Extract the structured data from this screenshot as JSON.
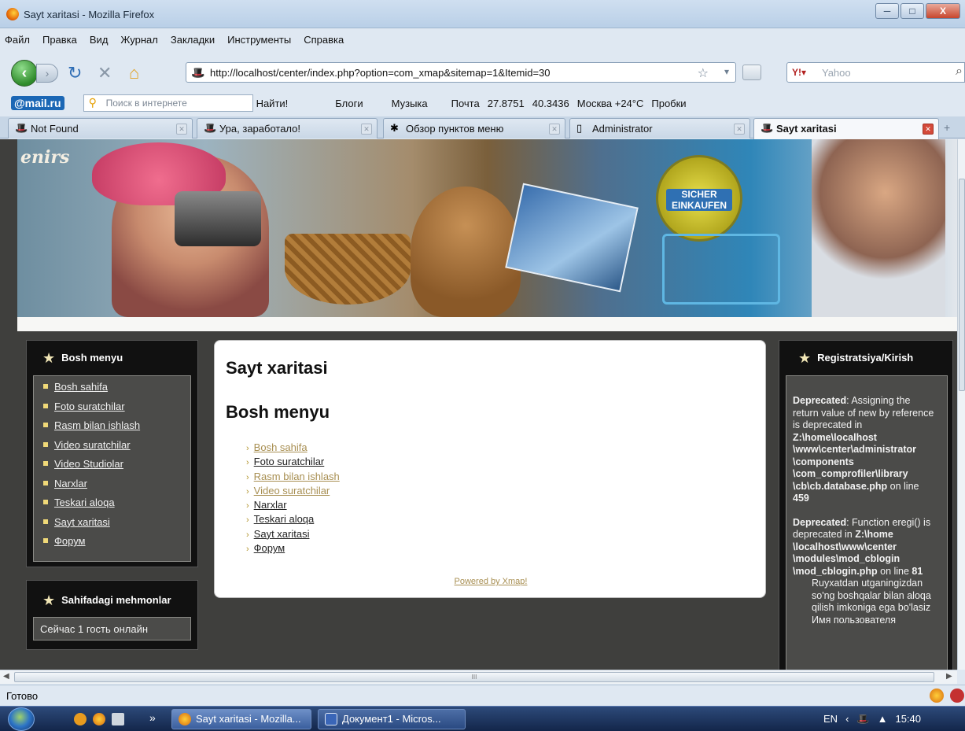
{
  "window": {
    "title": "Sayt xaritasi - Mozilla Firefox",
    "buttons": {
      "minimize": "─",
      "maximize": "□",
      "close": "X"
    }
  },
  "menubar": [
    "Файл",
    "Правка",
    "Вид",
    "Журнал",
    "Закладки",
    "Инструменты",
    "Справка"
  ],
  "navbar": {
    "url": "http://localhost/center/index.php?option=com_xmap&sitemap=1&Itemid=30",
    "search_placeholder": "Yahoo"
  },
  "mail_toolbar": {
    "logo": "@mail.ru",
    "search_placeholder": "Поиск в интернете",
    "find": "Найти!",
    "blogs": "Блоги",
    "music": "Музыка",
    "mail": "Почта",
    "usd": "27.8751",
    "eur": "40.3436",
    "weather": "Москва +24°C",
    "traffic": "Пробки"
  },
  "tabs": [
    {
      "label": "Not Found",
      "active": false
    },
    {
      "label": "Ура, заработало!",
      "active": false
    },
    {
      "label": "Обзор пунктов меню",
      "active": false
    },
    {
      "label": "Administrator",
      "active": false
    },
    {
      "label": "Sayt xaritasi",
      "active": true
    }
  ],
  "banner": {
    "word": "enirs",
    "seal": "SICHER EINKAUFEN"
  },
  "left_menu": {
    "title": "Bosh menyu",
    "items": [
      "Bosh sahifa",
      "Foto suratchilar",
      "Rasm bilan ishlash",
      "Video suratchilar",
      "Video Studiolar",
      "Narxlar",
      "Teskari aloqa",
      "Sayt xaritasi",
      "Форум"
    ]
  },
  "guests": {
    "title": "Sahifadagi mehmonlar",
    "text": "Сейчас 1 гость онлайн"
  },
  "content": {
    "title": "Sayt xaritasi",
    "menu_title": "Bosh menyu",
    "items": [
      {
        "label": "Bosh sahifa",
        "visited": true
      },
      {
        "label": "Foto suratchilar",
        "visited": false
      },
      {
        "label": "Rasm bilan ishlash",
        "visited": true
      },
      {
        "label": "Video suratchilar",
        "visited": true
      },
      {
        "label": "Narxlar",
        "visited": false
      },
      {
        "label": "Teskari aloqa",
        "visited": false
      },
      {
        "label": "Sayt xaritasi",
        "visited": false
      },
      {
        "label": "Форум",
        "visited": false
      }
    ],
    "powered": "Powered by Xmap!"
  },
  "login": {
    "title": "Registratsiya/Kirish",
    "deprecated1_label": "Deprecated",
    "deprecated1_text": ": Assigning the return value of new by reference is deprecated in ",
    "deprecated1_path": "Z:\\home\\localhost \\www\\center\\administrator \\components \\com_comprofiler\\library \\cb\\cb.database.php",
    "deprecated1_line_text": " on line ",
    "deprecated1_line": "459",
    "deprecated2_label": "Deprecated",
    "deprecated2_text": ": Function eregi() is deprecated in ",
    "deprecated2_path": "Z:\\home \\localhost\\www\\center \\modules\\mod_cblogin \\mod_cblogin.php",
    "deprecated2_line_text": " on line ",
    "deprecated2_line": "81",
    "info": "Ruyxatdan utganingizdan so'ng boshqalar bilan aloqa qilish imkoniga ega bo'lasiz",
    "cut": "Имя пользователя"
  },
  "hscroll": {
    "grip": "III"
  },
  "status": {
    "text": "Готово"
  },
  "taskbar": {
    "tasks": [
      "Sayt xaritasi - Mozilla...",
      "Документ1 - Micros..."
    ],
    "chevron": "»",
    "lang": "EN",
    "time": "15:40"
  }
}
